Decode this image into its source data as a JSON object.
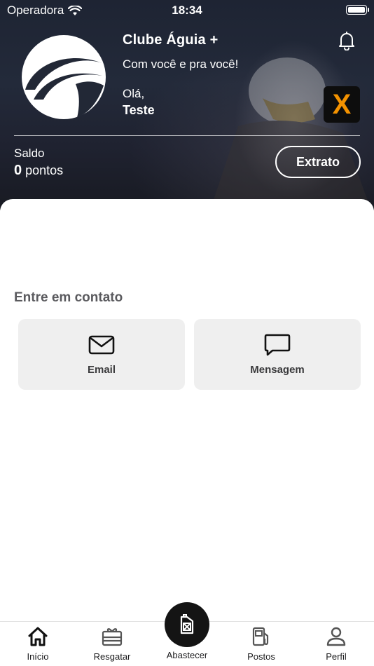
{
  "status_bar": {
    "carrier": "Operadora",
    "time": "18:34"
  },
  "header": {
    "club_name": "Clube Águia +",
    "tagline": "Com você e pra você!",
    "greeting": "Olá,",
    "user_name": "Teste",
    "balance_label": "Saldo",
    "balance_value": "0",
    "balance_unit": "pontos",
    "statement_button": "Extrato",
    "partner_badge_letter": "X",
    "partner_badge_color": "#f39200"
  },
  "contact": {
    "title": "Entre em contato",
    "options": [
      {
        "label": "Email",
        "icon": "mail-icon"
      },
      {
        "label": "Mensagem",
        "icon": "chat-bubble-icon"
      }
    ]
  },
  "tabbar": {
    "items": [
      {
        "label": "Início",
        "icon": "home-icon"
      },
      {
        "label": "Resgatar",
        "icon": "gift-card-icon"
      },
      {
        "label": "Abastecer",
        "icon": "fuel-can-icon"
      },
      {
        "label": "Postos",
        "icon": "gas-station-icon"
      },
      {
        "label": "Perfil",
        "icon": "user-icon"
      }
    ]
  }
}
